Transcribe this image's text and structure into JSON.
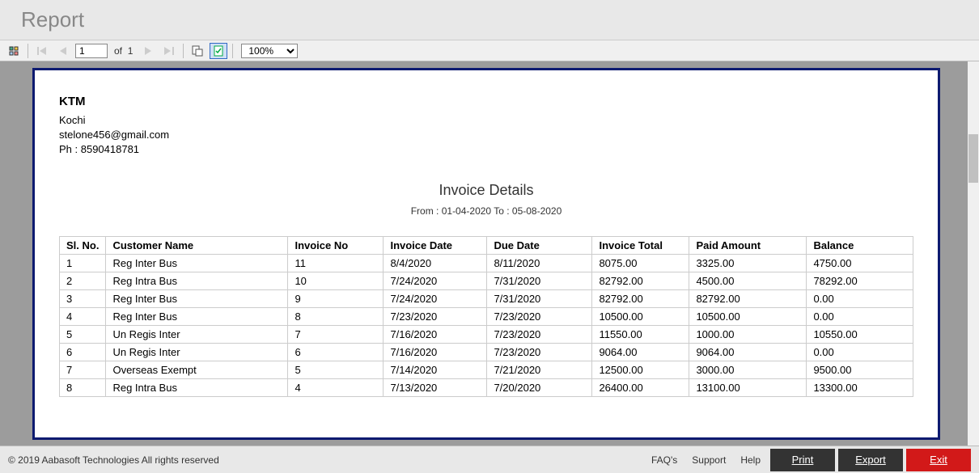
{
  "window": {
    "title": "Report"
  },
  "nav": {
    "current_page": "1",
    "total_pages": "1",
    "of_label": "of",
    "zoom": "100%"
  },
  "company": {
    "name": "KTM",
    "city": "Kochi",
    "email": "stelone456@gmail.com",
    "phone": "Ph : 8590418781"
  },
  "report": {
    "title": "Invoice Details",
    "range": "From : 01-04-2020 To : 05-08-2020"
  },
  "columns": {
    "sl": "Sl. No.",
    "customer": "Customer Name",
    "invno": "Invoice No",
    "invdate": "Invoice Date",
    "duedate": "Due Date",
    "total": "Invoice Total",
    "paid": "Paid Amount",
    "balance": "Balance"
  },
  "rows": [
    {
      "sl": "1",
      "customer": "Reg Inter Bus",
      "invno": "11",
      "invdate": "8/4/2020",
      "duedate": "8/11/2020",
      "total": "8075.00",
      "paid": "3325.00",
      "balance": "4750.00"
    },
    {
      "sl": "2",
      "customer": "Reg Intra Bus",
      "invno": "10",
      "invdate": "7/24/2020",
      "duedate": "7/31/2020",
      "total": "82792.00",
      "paid": "4500.00",
      "balance": "78292.00"
    },
    {
      "sl": "3",
      "customer": "Reg Inter Bus",
      "invno": "9",
      "invdate": "7/24/2020",
      "duedate": "7/31/2020",
      "total": "82792.00",
      "paid": "82792.00",
      "balance": "0.00"
    },
    {
      "sl": "4",
      "customer": "Reg Inter Bus",
      "invno": "8",
      "invdate": "7/23/2020",
      "duedate": "7/23/2020",
      "total": "10500.00",
      "paid": "10500.00",
      "balance": "0.00"
    },
    {
      "sl": "5",
      "customer": "Un Regis Inter",
      "invno": "7",
      "invdate": "7/16/2020",
      "duedate": "7/23/2020",
      "total": "11550.00",
      "paid": "1000.00",
      "balance": "10550.00"
    },
    {
      "sl": "6",
      "customer": "Un Regis Inter",
      "invno": "6",
      "invdate": "7/16/2020",
      "duedate": "7/23/2020",
      "total": "9064.00",
      "paid": "9064.00",
      "balance": "0.00"
    },
    {
      "sl": "7",
      "customer": "Overseas Exempt",
      "invno": "5",
      "invdate": "7/14/2020",
      "duedate": "7/21/2020",
      "total": "12500.00",
      "paid": "3000.00",
      "balance": "9500.00"
    },
    {
      "sl": "8",
      "customer": "Reg Intra Bus",
      "invno": "4",
      "invdate": "7/13/2020",
      "duedate": "7/20/2020",
      "total": "26400.00",
      "paid": "13100.00",
      "balance": "13300.00"
    }
  ],
  "footer": {
    "copyright": "© 2019 Aabasoft Technologies All rights reserved",
    "links": {
      "faqs": "FAQ's",
      "support": "Support",
      "help": "Help"
    },
    "buttons": {
      "print": "Print",
      "export": "Export",
      "exit": "Exit"
    }
  }
}
